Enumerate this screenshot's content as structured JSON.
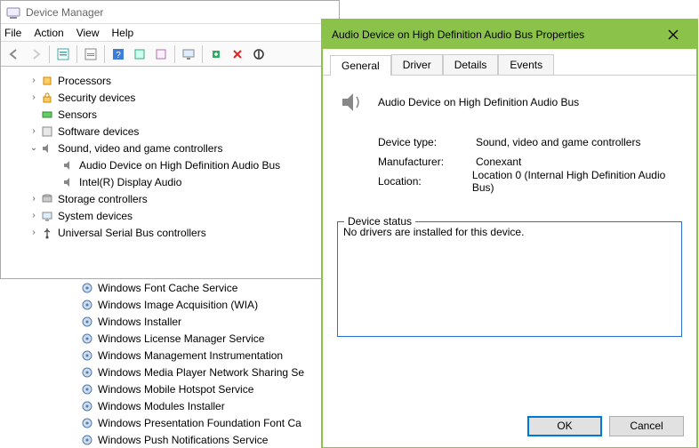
{
  "dm": {
    "title": "Device Manager",
    "menu": {
      "file": "File",
      "action": "Action",
      "view": "View",
      "help": "Help"
    },
    "tree": [
      {
        "label": "Processors",
        "icon": "cpu",
        "level": 1,
        "expander": ">"
      },
      {
        "label": "Security devices",
        "icon": "lock",
        "level": 1,
        "expander": ">"
      },
      {
        "label": "Sensors",
        "icon": "sensor",
        "level": 1,
        "expander": ""
      },
      {
        "label": "Software devices",
        "icon": "software",
        "level": 1,
        "expander": ">"
      },
      {
        "label": "Sound, video and game controllers",
        "icon": "speaker",
        "level": 1,
        "expander": "v"
      },
      {
        "label": "Audio Device on High Definition Audio Bus",
        "icon": "speaker",
        "level": 2,
        "expander": ""
      },
      {
        "label": "Intel(R) Display Audio",
        "icon": "speaker",
        "level": 2,
        "expander": ""
      },
      {
        "label": "Storage controllers",
        "icon": "storage",
        "level": 1,
        "expander": ">"
      },
      {
        "label": "System devices",
        "icon": "pc",
        "level": 1,
        "expander": ">"
      },
      {
        "label": "Universal Serial Bus controllers",
        "icon": "usb",
        "level": 1,
        "expander": ">"
      }
    ]
  },
  "services": [
    "Windows Font Cache Service",
    "Windows Image Acquisition (WIA)",
    "Windows Installer",
    "Windows License Manager Service",
    "Windows Management Instrumentation",
    "Windows Media Player Network Sharing Se",
    "Windows Mobile Hotspot Service",
    "Windows Modules Installer",
    "Windows Presentation Foundation Font Ca",
    "Windows Push Notifications Service"
  ],
  "props": {
    "title": "Audio Device on High Definition Audio Bus Properties",
    "tabs": {
      "general": "General",
      "driver": "Driver",
      "details": "Details",
      "events": "Events"
    },
    "device_name": "Audio Device on High Definition Audio Bus",
    "rows": {
      "type_label": "Device type:",
      "type_value": "Sound, video and game controllers",
      "manu_label": "Manufacturer:",
      "manu_value": "Conexant",
      "loc_label": "Location:",
      "loc_value": "Location 0 (Internal High Definition Audio Bus)"
    },
    "status_label": "Device status",
    "status_text": "No drivers are installed for this device.",
    "ok": "OK",
    "cancel": "Cancel"
  }
}
